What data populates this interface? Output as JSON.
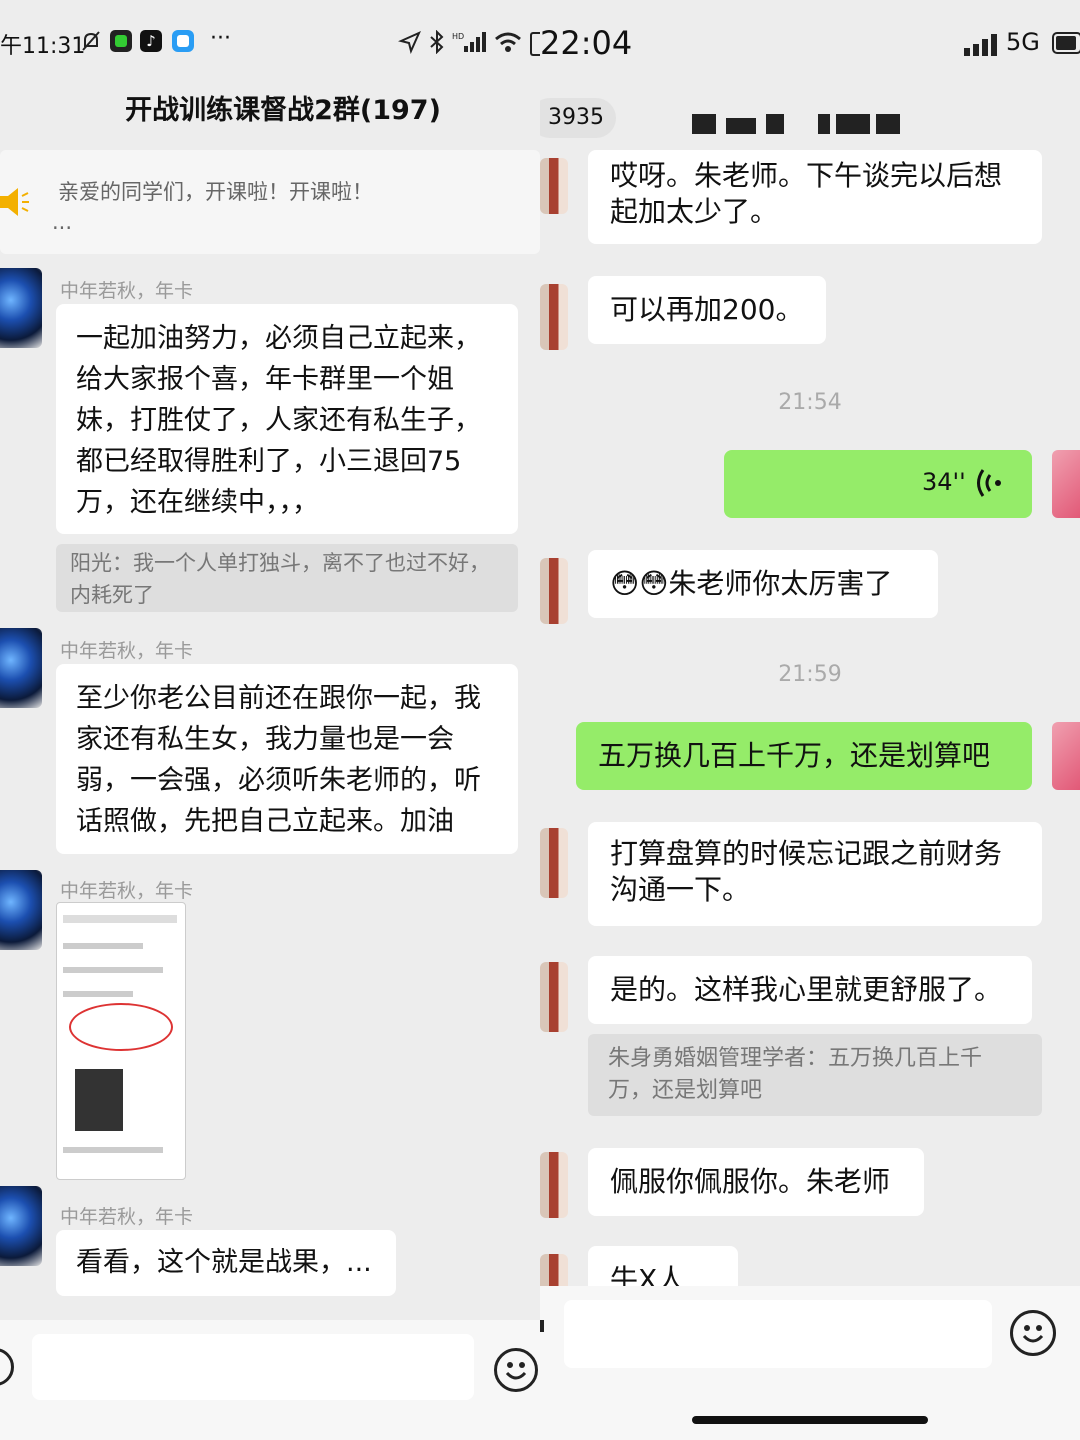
{
  "left": {
    "status": {
      "time": "午11:31",
      "dots": "···"
    },
    "title": "开战训练课督战2群(197)",
    "notice": {
      "text": "亲爱的同学们，开课啦！开课啦！",
      "more": "..."
    },
    "messages": [
      {
        "name": "中年若秋，年卡",
        "text": "一起加油努力，必须自己立起来，给大家报个喜，年卡群里一个姐妹，打胜仗了，人家还有私生子，都已经取得胜利了，小三退回75万，还在继续中，，，",
        "quote": "阳光：我一个人单打独斗，离不了也过不好，内耗死了"
      },
      {
        "name": "中年若秋，年卡",
        "text": "至少你老公目前还在跟你一起，我家还有私生女，我力量也是一会弱，一会强，必须听朱老师的，听话照做，先把自己立起来。加油"
      },
      {
        "name": "中年若秋，年卡",
        "image": "screenshot-thumbnail"
      },
      {
        "name": "中年若秋，年卡",
        "text": "看看，这个就是战果，..."
      }
    ]
  },
  "right": {
    "status": {
      "time": "22:04",
      "network": "5G"
    },
    "header": {
      "badge": "3935"
    },
    "messages": [
      {
        "side": "in",
        "text": "哎呀。朱老师。下午谈完以后想起加太少了。"
      },
      {
        "side": "in",
        "text": "可以再加200。"
      },
      {
        "time": "21:54"
      },
      {
        "side": "out",
        "voice": "34''"
      },
      {
        "side": "in",
        "text": "😳😳朱老师你太厉害了"
      },
      {
        "time": "21:59"
      },
      {
        "side": "out",
        "text": "五万换几百上千万，还是划算吧"
      },
      {
        "side": "in",
        "text": "打算盘算的时候忘记跟之前财务沟通一下。"
      },
      {
        "side": "in",
        "text": "是的。这样我心里就更舒服了。",
        "quote": "朱身勇婚姻管理学者：五万换几百上千万，还是划算吧"
      },
      {
        "side": "in",
        "text": "佩服你佩服你。朱老师"
      },
      {
        "side": "in",
        "text": "牛X人"
      }
    ]
  },
  "colors": {
    "green_bubble": "#95ec69",
    "background": "#ededed",
    "white_bubble": "#ffffff"
  }
}
